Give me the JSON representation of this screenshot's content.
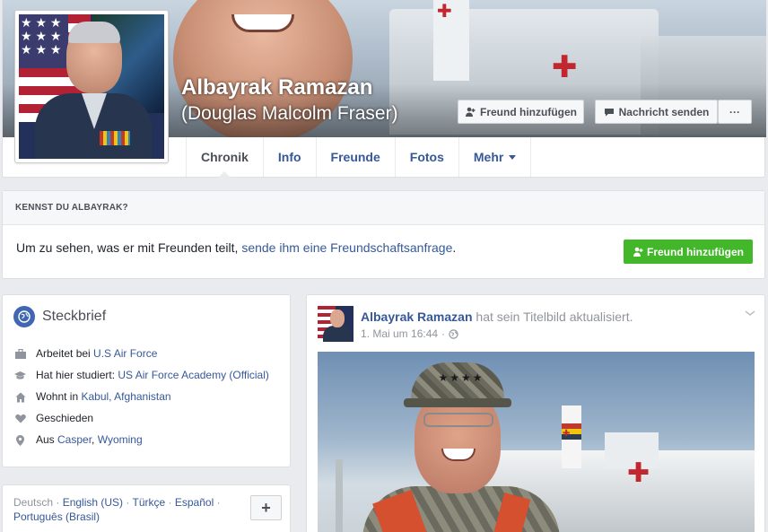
{
  "profile": {
    "name": "Albayrak Ramazan",
    "alternate_name": "(Douglas Malcolm Fraser)"
  },
  "header_actions": {
    "add_friend": "Freund hinzufügen",
    "send_message": "Nachricht senden",
    "more": "···"
  },
  "tabs": [
    {
      "label": "Chronik",
      "active": true
    },
    {
      "label": "Info"
    },
    {
      "label": "Freunde"
    },
    {
      "label": "Fotos"
    },
    {
      "label": "Mehr"
    }
  ],
  "know_card": {
    "heading": "KENNST DU ALBAYRAK?",
    "text_before": "Um zu sehen, was er mit Freunden teilt, ",
    "link": "sende ihm eine Freundschaftsanfrage",
    "text_after": ".",
    "button": "Freund hinzufügen"
  },
  "intro": {
    "title": "Steckbrief",
    "items": [
      {
        "icon": "briefcase-icon",
        "prefix": "Arbeitet bei ",
        "link": "U.S Air Force",
        "suffix": ""
      },
      {
        "icon": "graduation-cap-icon",
        "prefix": "Hat hier studiert: ",
        "link": "US Air Force Academy (Official)",
        "suffix": ""
      },
      {
        "icon": "home-icon",
        "prefix": "Wohnt in ",
        "link": "Kabul, Afghanistan",
        "suffix": ""
      },
      {
        "icon": "heart-icon",
        "prefix": "Geschieden",
        "link": "",
        "suffix": ""
      },
      {
        "icon": "location-pin-icon",
        "prefix": "Aus ",
        "link": "Casper",
        "suffix": ", ",
        "link2": "Wyoming"
      }
    ]
  },
  "languages": {
    "current": "Deutsch",
    "options": [
      "English (US)",
      "Türkçe",
      "Español",
      "Português (Brasil)"
    ],
    "add": "+"
  },
  "post": {
    "author": "Albayrak Ramazan",
    "action": "hat sein Titelbild aktualisiert.",
    "timestamp": "1. Mai um 16:44",
    "separator": "·"
  },
  "colors": {
    "link": "#365899",
    "green_button": "#42b72a",
    "background": "#e9ebee"
  }
}
